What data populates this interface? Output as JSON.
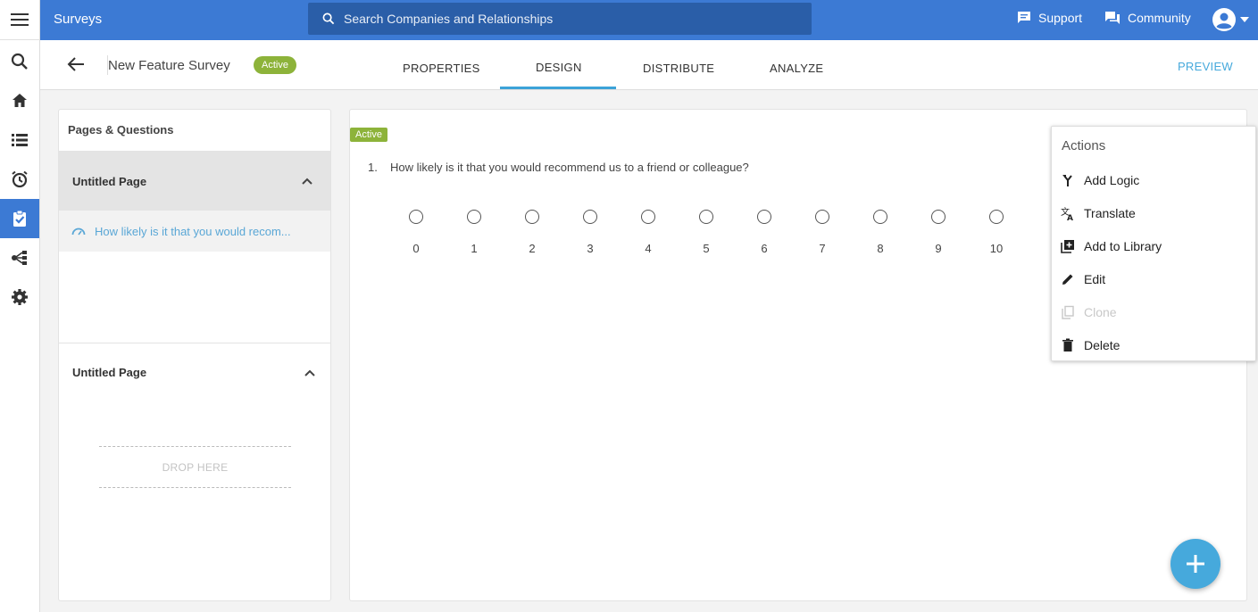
{
  "app": {
    "title": "Surveys"
  },
  "search": {
    "placeholder": "Search Companies and Relationships"
  },
  "top_links": {
    "support": "Support",
    "community": "Community"
  },
  "rail": {
    "items": [
      {
        "icon": "search-icon"
      },
      {
        "icon": "home-icon"
      },
      {
        "icon": "list-icon"
      },
      {
        "icon": "alarm-clock-icon"
      },
      {
        "icon": "survey-clipboard-icon",
        "active": true
      },
      {
        "icon": "hierarchy-icon"
      },
      {
        "icon": "gear-icon"
      }
    ]
  },
  "survey": {
    "name": "New Feature Survey",
    "status": "Active"
  },
  "tabs": [
    {
      "label": "PROPERTIES"
    },
    {
      "label": "DESIGN",
      "active": true
    },
    {
      "label": "DISTRIBUTE"
    },
    {
      "label": "ANALYZE"
    }
  ],
  "preview_label": "PREVIEW",
  "left_panel": {
    "title": "Pages & Questions",
    "pages": [
      {
        "title": "Untitled Page",
        "questions": [
          "How likely is it that you would recom..."
        ]
      },
      {
        "title": "Untitled Page",
        "drop_label": "DROP HERE"
      }
    ]
  },
  "canvas": {
    "badge": "Active",
    "question": {
      "number": "1.",
      "text": "How likely is it that you would recommend us to a friend or colleague?",
      "scale": [
        "0",
        "1",
        "2",
        "3",
        "4",
        "5",
        "6",
        "7",
        "8",
        "9",
        "10"
      ]
    }
  },
  "actions_menu": {
    "title": "Actions",
    "items": [
      {
        "label": "Add Logic",
        "icon": "logic-merge-icon",
        "enabled": true
      },
      {
        "label": "Translate",
        "icon": "translate-icon",
        "enabled": true
      },
      {
        "label": "Add to Library",
        "icon": "library-add-icon",
        "enabled": true
      },
      {
        "label": "Edit",
        "icon": "pencil-icon",
        "enabled": true
      },
      {
        "label": "Clone",
        "icon": "copy-icon",
        "enabled": false
      },
      {
        "label": "Delete",
        "icon": "trash-icon",
        "enabled": true
      }
    ]
  },
  "colors": {
    "primary": "#3c7ad4",
    "accent": "#46a9dc",
    "active_badge": "#8db33a"
  }
}
